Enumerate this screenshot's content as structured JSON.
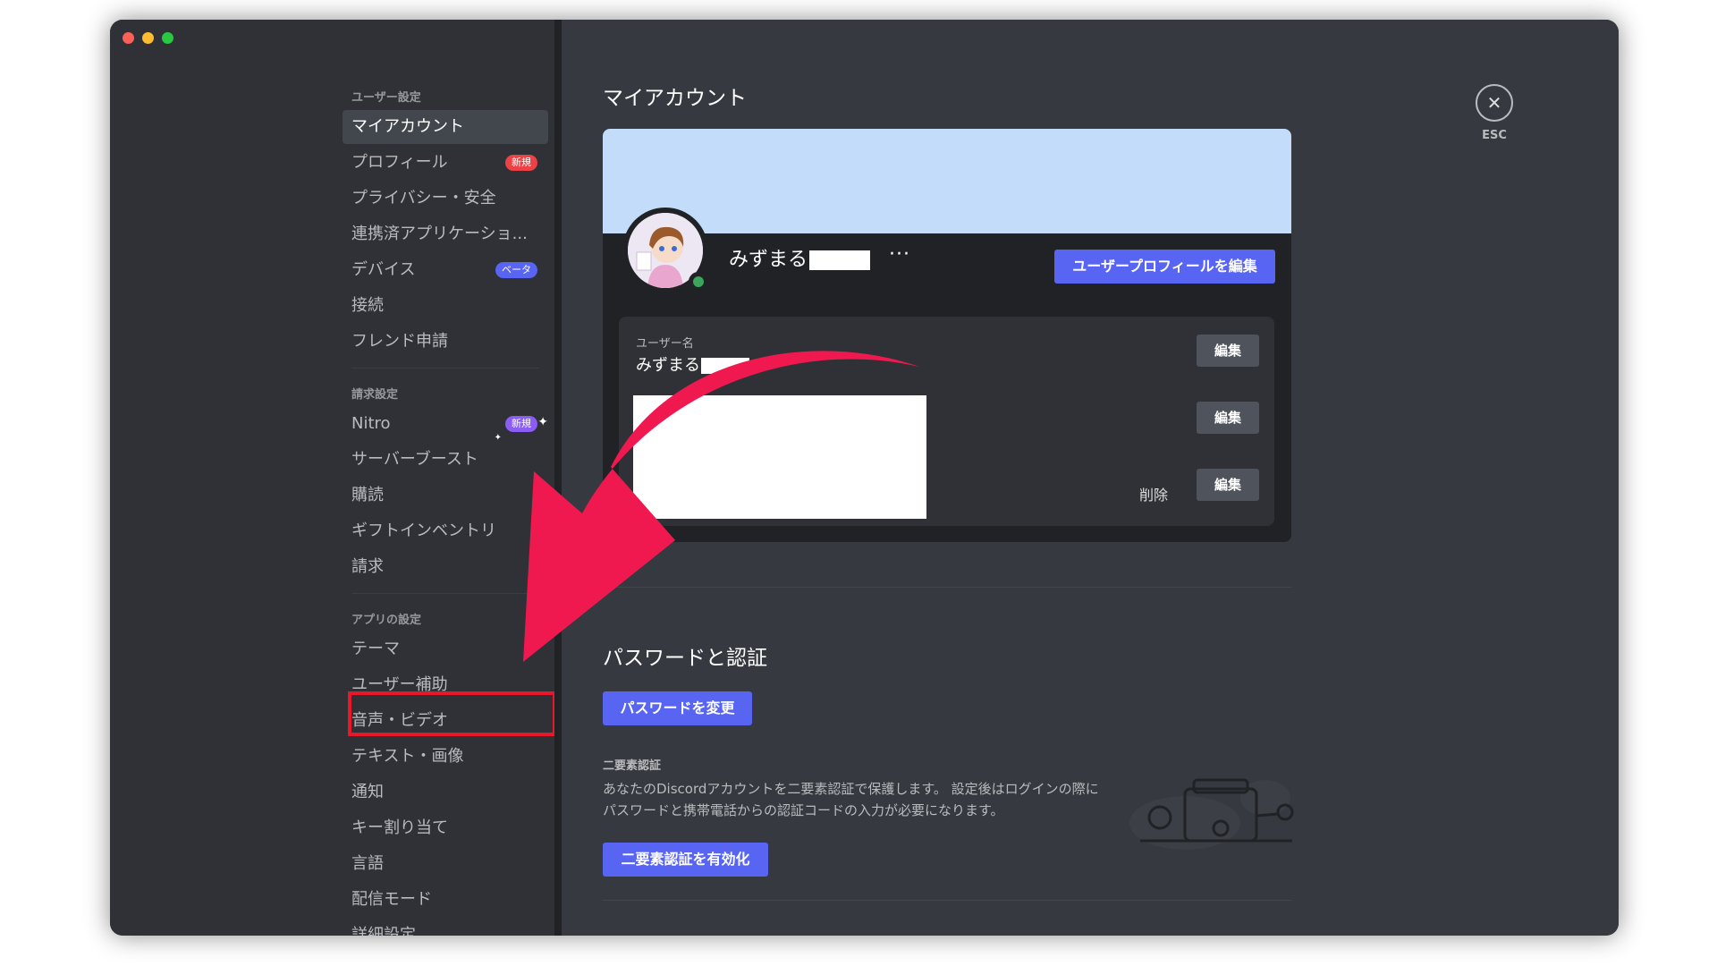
{
  "window": {
    "traffic_lights": [
      "close",
      "minimize",
      "zoom"
    ]
  },
  "sidebar": {
    "sections": [
      {
        "header": "ユーザー設定",
        "items": [
          {
            "label": "マイアカウント",
            "active": true
          },
          {
            "label": "プロフィール",
            "badge": "新規"
          },
          {
            "label": "プライバシー・安全"
          },
          {
            "label": "連携済アプリケーショ..."
          },
          {
            "label": "デバイス",
            "badge": "ベータ"
          },
          {
            "label": "接続"
          },
          {
            "label": "フレンド申請"
          }
        ]
      },
      {
        "header": "請求設定",
        "items": [
          {
            "label": "Nitro",
            "badge": "新規"
          },
          {
            "label": "サーバーブースト"
          },
          {
            "label": "購読"
          },
          {
            "label": "ギフトインベントリ"
          },
          {
            "label": "請求"
          }
        ]
      },
      {
        "header": "アプリの設定",
        "items": [
          {
            "label": "テーマ"
          },
          {
            "label": "ユーザー補助"
          },
          {
            "label": "音声・ビデオ"
          },
          {
            "label": "テキスト・画像"
          },
          {
            "label": "通知"
          },
          {
            "label": "キー割り当て"
          },
          {
            "label": "言語"
          },
          {
            "label": "配信モード"
          },
          {
            "label": "詳細設定"
          }
        ]
      }
    ]
  },
  "main": {
    "title": "マイアカウント",
    "esc_label": "ESC",
    "profile": {
      "display_name": "みずまる",
      "more": "···",
      "edit_profile_button": "ユーザープロフィールを編集",
      "status": "online"
    },
    "fields": {
      "username_label": "ユーザー名",
      "username_value": "みずまる",
      "edit_label": "編集",
      "delete_label": "削除"
    },
    "password": {
      "title": "パスワードと認証",
      "change_button": "パスワードを変更",
      "twofa_header": "二要素認証",
      "twofa_description": "あなたのDiscordアカウントを二要素認証で保護します。 設定後はログインの際に パスワードと携帯電話からの認証コードの入力が必要になります。",
      "enable_button": "二要素認証を有効化"
    }
  },
  "colors": {
    "accent": "#5865f2",
    "arrow": "#f0194f",
    "highlight_box": "#e8182a",
    "banner": "#c3dcf9",
    "online": "#3ba55d"
  }
}
